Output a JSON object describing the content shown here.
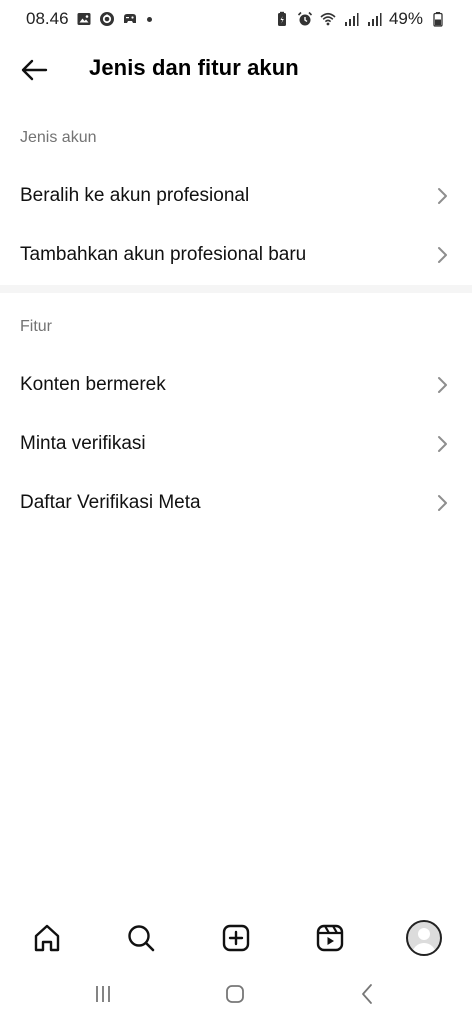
{
  "status_bar": {
    "time": "08.46",
    "battery": "49%",
    "icons_left": [
      "image-icon",
      "sync-icon",
      "game-icon",
      "dot-icon"
    ],
    "icons_right": [
      "battery-saver-icon",
      "alarm-icon",
      "wifi-icon",
      "signal-icon",
      "signal-icon-2",
      "battery-icon"
    ]
  },
  "header": {
    "title": "Jenis dan fitur akun",
    "back_icon": "arrow-left-icon"
  },
  "sections": [
    {
      "label": "Jenis akun",
      "items": [
        {
          "label": "Beralih ke akun profesional"
        },
        {
          "label": "Tambahkan akun profesional baru"
        }
      ]
    },
    {
      "label": "Fitur",
      "items": [
        {
          "label": "Konten bermerek"
        },
        {
          "label": "Minta verifikasi"
        },
        {
          "label": "Daftar Verifikasi Meta"
        }
      ]
    }
  ],
  "bottom_nav": [
    "home-icon",
    "search-icon",
    "create-icon",
    "reels-icon",
    "profile-avatar"
  ],
  "system_nav": [
    "recent-apps-icon",
    "home-button-icon",
    "back-nav-icon"
  ],
  "colors": {
    "text": "#111111",
    "secondary_text": "#737373",
    "chevron": "#8e8e8e",
    "divider": "#f5f5f5"
  }
}
